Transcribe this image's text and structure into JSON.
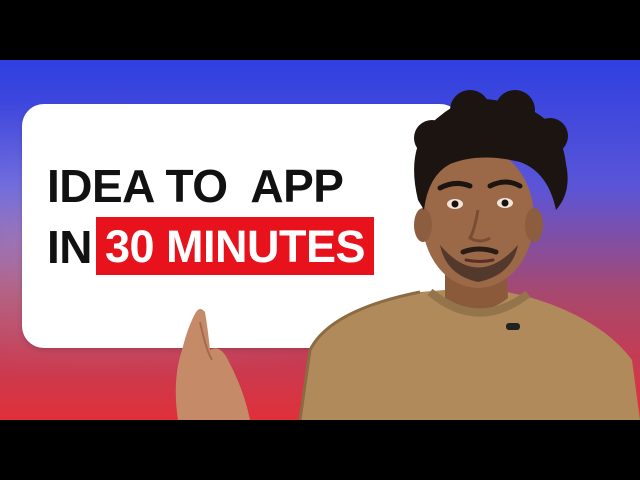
{
  "thumbnail": {
    "headline_line1": "IDEA TO  APP",
    "headline_line2_prefix": "IN",
    "headline_highlight": "30 MINUTES"
  },
  "colors": {
    "background_top": "#2f3fe0",
    "background_bottom": "#e0303a",
    "card": "#ffffff",
    "highlight": "#e8121c",
    "headline_text": "#111111",
    "sweater": "#b08a5a"
  }
}
